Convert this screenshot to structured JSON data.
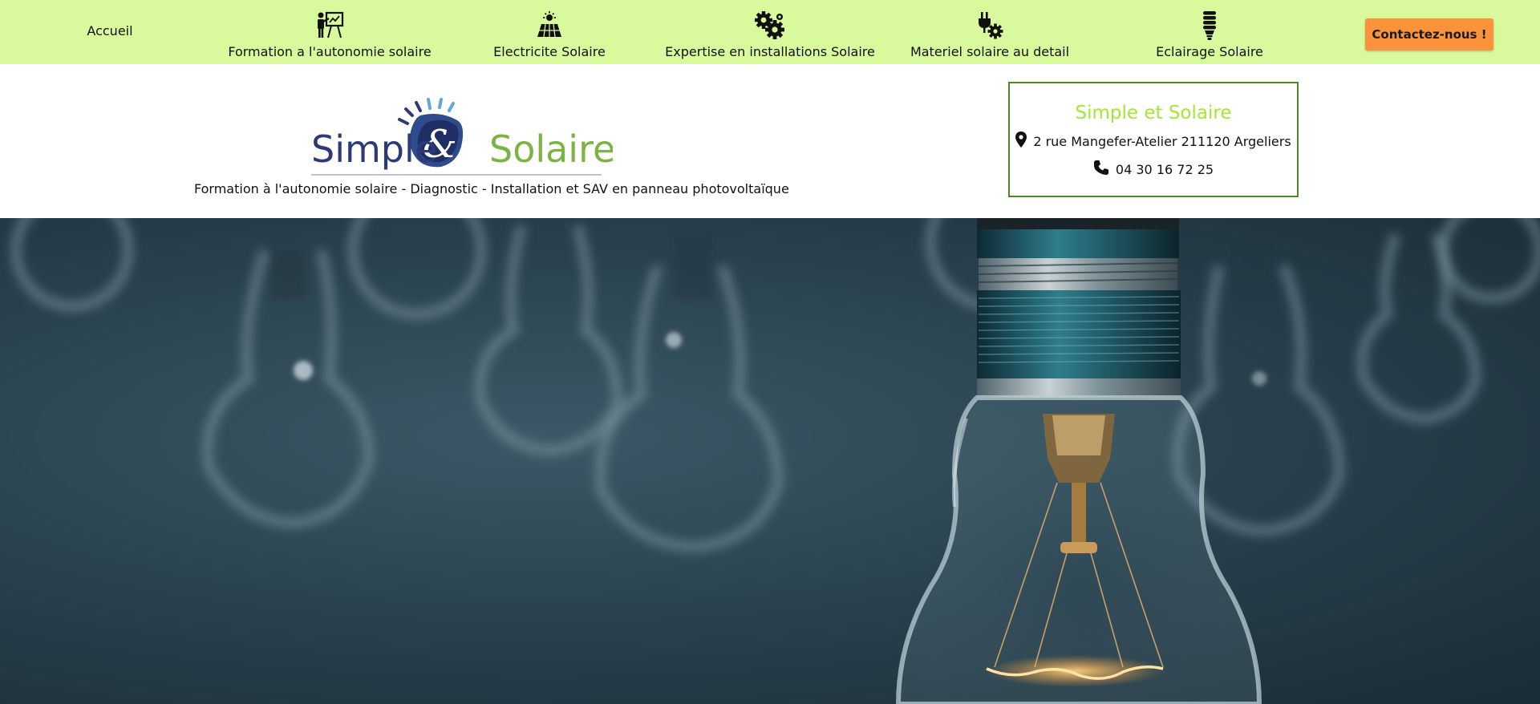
{
  "nav": {
    "home_label": "Accueil",
    "items": [
      {
        "label": "Formation a l'autonomie solaire",
        "icon": "teacher-board-icon"
      },
      {
        "label": "Electricite Solaire",
        "icon": "solar-panel-icon"
      },
      {
        "label": "Expertise en installations Solaire",
        "icon": "gears-icon"
      },
      {
        "label": "Materiel solaire au detail",
        "icon": "plug-gear-icon"
      },
      {
        "label": "Eclairage Solaire",
        "icon": "eco-bulb-icon"
      }
    ],
    "contact_label": "Contactez-nous !"
  },
  "header": {
    "logo": {
      "word1": "Simple",
      "ampersand": "&",
      "word2": "Solaire"
    },
    "tagline": "Formation à l'autonomie solaire - Diagnostic - Installation et SAV en panneau photovoltaïque",
    "info": {
      "title": "Simple et Solaire",
      "address": "2 rue Mangefer-Atelier 211120 Argeliers",
      "phone": "04 30 16 72 25"
    }
  },
  "colors": {
    "nav_bg": "#d9f99d",
    "accent_green": "#a3e635",
    "logo_navy": "#2e3a78",
    "logo_green": "#7cb342",
    "button_orange": "#fb923c",
    "box_border": "#4d8c1a"
  }
}
